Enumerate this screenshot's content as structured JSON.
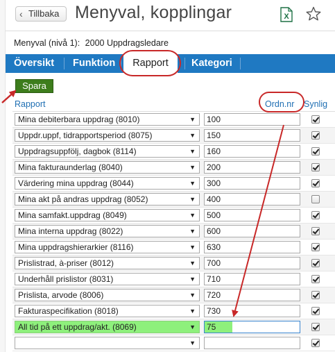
{
  "header": {
    "back_label": "Tillbaka",
    "title": "Menyval, kopplingar",
    "export_icon": "excel-icon",
    "favorite_icon": "star-icon"
  },
  "subheader": {
    "label": "Menyval (nivå 1):",
    "value": "2000 Uppdragsledare"
  },
  "tabs": [
    {
      "label": "Översikt"
    },
    {
      "label": "Funktion"
    },
    {
      "label": "Rapport",
      "active": true
    },
    {
      "label": "Kategori"
    }
  ],
  "toolbar": {
    "save_label": "Spara"
  },
  "table": {
    "columns": {
      "report": "Rapport",
      "order": "Ordn.nr",
      "visible": "Synlig"
    },
    "rows": [
      {
        "report": "Mina debiterbara uppdrag (8010)",
        "order": "100",
        "visible": true
      },
      {
        "report": "Uppdr.uppf, tidrapportsperiod (8075)",
        "order": "150",
        "visible": true
      },
      {
        "report": "Uppdragsuppfölj, dagbok (8114)",
        "order": "160",
        "visible": true
      },
      {
        "report": "Mina fakturaunderlag (8040)",
        "order": "200",
        "visible": true
      },
      {
        "report": "Värdering mina uppdrag (8044)",
        "order": "300",
        "visible": true
      },
      {
        "report": "Mina akt på andras uppdrag (8052)",
        "order": "400",
        "visible": false
      },
      {
        "report": "Mina samfakt.uppdrag (8049)",
        "order": "500",
        "visible": true
      },
      {
        "report": "Mina interna uppdrag (8022)",
        "order": "600",
        "visible": true
      },
      {
        "report": "Mina uppdragshierarkier (8116)",
        "order": "630",
        "visible": true
      },
      {
        "report": "Prislistrad, à-priser (8012)",
        "order": "700",
        "visible": true
      },
      {
        "report": "Underhåll prislistor (8031)",
        "order": "710",
        "visible": true
      },
      {
        "report": "Prislista, arvode (8006)",
        "order": "720",
        "visible": true
      },
      {
        "report": "Fakturaspecifikation (8018)",
        "order": "730",
        "visible": true
      },
      {
        "report": "All tid på ett uppdrag/akt. (8069)",
        "order": "75",
        "visible": true,
        "highlight": true
      },
      {
        "report": "",
        "order": "",
        "visible": true
      }
    ]
  },
  "colors": {
    "tab_bar": "#1f79c2",
    "save_button": "#3d7d1c",
    "annotation": "#c82828",
    "highlight": "#8ef07c",
    "header_link": "#1f6fb3"
  }
}
